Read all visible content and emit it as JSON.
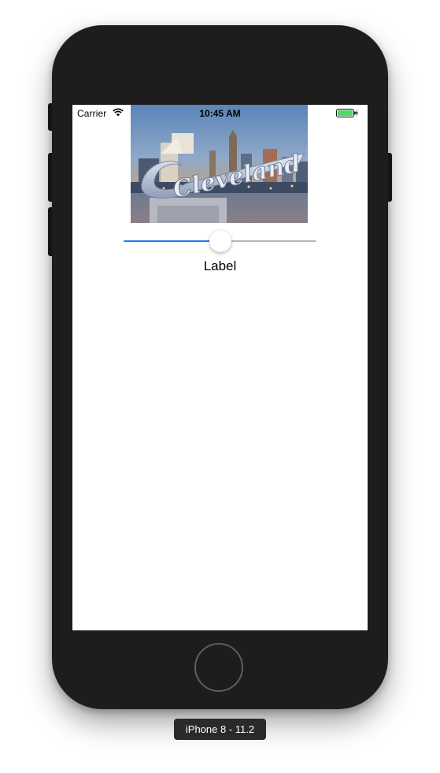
{
  "status_bar": {
    "carrier": "Carrier",
    "time": "10:45 AM",
    "battery_color": "#4cd964"
  },
  "image": {
    "sign_text": "Cleveland",
    "description_icon": "city-photo"
  },
  "slider": {
    "value_fraction": 0.5,
    "min_track_color": "#1a7cf7",
    "max_track_color": "#b6b6b6"
  },
  "label": {
    "text": "Label"
  },
  "device": {
    "caption": "iPhone 8 - 11.2"
  }
}
